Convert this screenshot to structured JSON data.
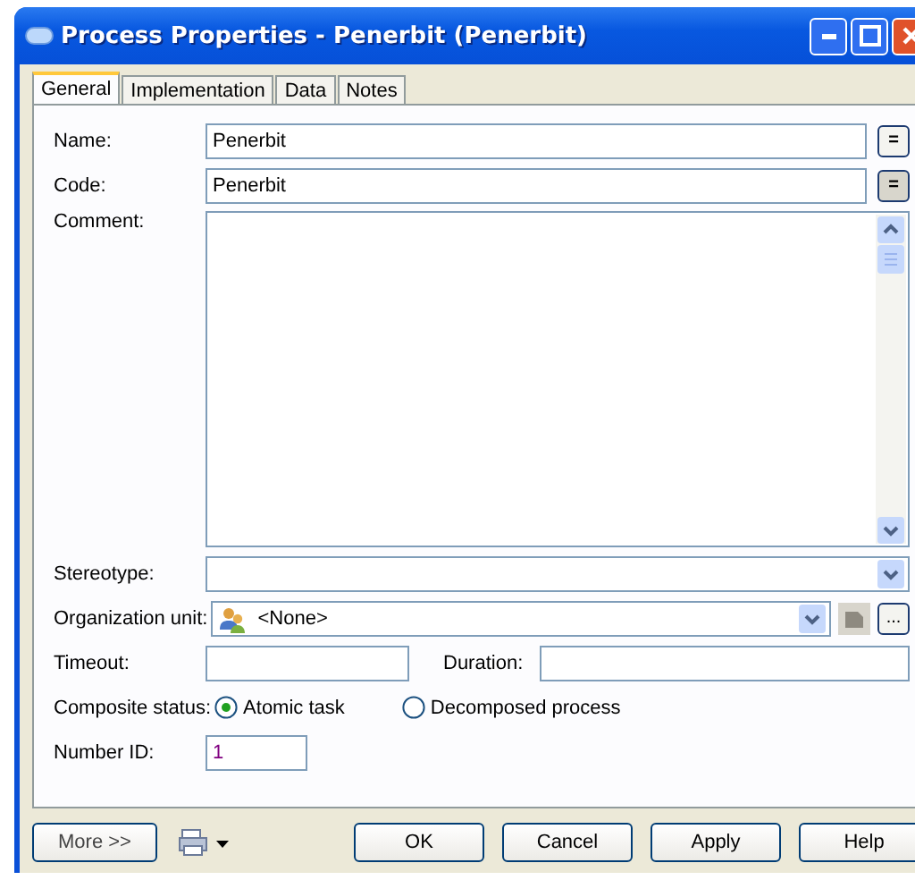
{
  "window": {
    "title": "Process Properties - Penerbit (Penerbit)"
  },
  "tabs": [
    {
      "label": "General",
      "selected": true
    },
    {
      "label": "Implementation",
      "selected": false
    },
    {
      "label": "Data",
      "selected": false
    },
    {
      "label": "Notes",
      "selected": false
    }
  ],
  "name": {
    "label": "Name:",
    "value": "Penerbit",
    "button": "=",
    "pressed": false
  },
  "code": {
    "label": "Code:",
    "value": "Penerbit",
    "button": "=",
    "pressed": true
  },
  "comment": {
    "label": "Comment:"
  },
  "stereotype": {
    "label": "Stereotype:"
  },
  "organization_unit": {
    "label": "Organization unit:",
    "value": "<None>",
    "button": "..."
  },
  "timeout": {
    "label": "Timeout:"
  },
  "duration": {
    "label": "Duration:"
  },
  "composite_status": {
    "label": "Composite status:",
    "options": [
      {
        "label": "Atomic task",
        "selected": true
      },
      {
        "label": "Decomposed process",
        "selected": false
      }
    ]
  },
  "number_id": {
    "label": "Number ID:",
    "value": "1"
  },
  "buttons": {
    "more": "More >>",
    "actions": [
      "OK",
      "Cancel",
      "Apply",
      "Help"
    ]
  }
}
